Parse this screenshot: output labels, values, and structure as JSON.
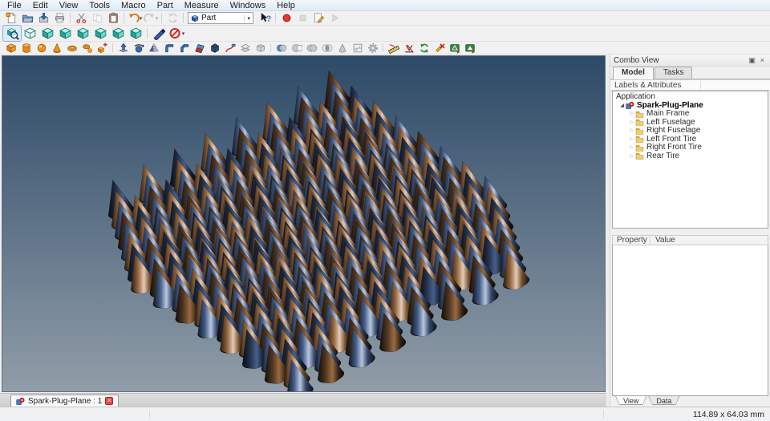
{
  "menubar": {
    "items": [
      "File",
      "Edit",
      "View",
      "Tools",
      "Macro",
      "Part",
      "Measure",
      "Windows",
      "Help"
    ]
  },
  "toolbars": {
    "workbench": {
      "value": "Part"
    },
    "row1_left": [
      {
        "name": "file",
        "items": [
          {
            "id": "new",
            "label": "New"
          },
          {
            "id": "open",
            "label": "Open"
          },
          {
            "id": "save",
            "label": "Save"
          },
          {
            "id": "print",
            "label": "Print"
          }
        ]
      },
      {
        "name": "edit",
        "items": [
          {
            "id": "cut",
            "label": "Cut"
          },
          {
            "id": "copy",
            "label": "Copy",
            "disabled": true
          },
          {
            "id": "paste",
            "label": "Paste"
          }
        ]
      },
      {
        "name": "undo-redo",
        "items": [
          {
            "id": "undo",
            "label": "Undo",
            "dropdown": true
          },
          {
            "id": "redo",
            "label": "Redo",
            "disabled": true,
            "dropdown": true
          }
        ]
      },
      {
        "name": "refresh",
        "items": [
          {
            "id": "refresh",
            "label": "Refresh",
            "disabled": true
          }
        ]
      }
    ],
    "row1_right": [
      {
        "name": "help",
        "items": [
          {
            "id": "whatsthis",
            "label": "What's This?"
          }
        ]
      },
      {
        "name": "macro",
        "items": [
          {
            "id": "record",
            "label": "Macro recording"
          },
          {
            "id": "stop",
            "label": "Stop macro recording",
            "disabled": true
          },
          {
            "id": "macro-edit",
            "label": "Macros..."
          },
          {
            "id": "play",
            "label": "Execute macro",
            "disabled": true
          }
        ]
      }
    ],
    "view_row": [
      {
        "name": "navigation",
        "items": [
          {
            "id": "fit-all",
            "label": "Fit all",
            "active": true
          },
          {
            "id": "axonometric",
            "label": "Axonometric"
          },
          {
            "id": "view-front",
            "label": "Front"
          },
          {
            "id": "view-top",
            "label": "Top"
          },
          {
            "id": "view-right",
            "label": "Right"
          },
          {
            "id": "view-rear",
            "label": "Rear"
          },
          {
            "id": "view-bottom",
            "label": "Bottom"
          },
          {
            "id": "view-left",
            "label": "Left"
          }
        ]
      },
      {
        "name": "view-tools",
        "items": [
          {
            "id": "measure-distance",
            "label": "Measure distance"
          },
          {
            "id": "clipping-plane",
            "label": "Clipping plane",
            "dropdown": true
          }
        ]
      }
    ],
    "part_row": [
      {
        "name": "primitives",
        "items": [
          {
            "id": "box",
            "label": "Box"
          },
          {
            "id": "cylinder",
            "label": "Cylinder"
          },
          {
            "id": "sphere",
            "label": "Sphere"
          },
          {
            "id": "cone",
            "label": "Cone"
          },
          {
            "id": "torus",
            "label": "Torus"
          },
          {
            "id": "create-primitives",
            "label": "Create primitives..."
          },
          {
            "id": "shape-builder",
            "label": "Shape builder..."
          }
        ]
      },
      {
        "name": "modify",
        "items": [
          {
            "id": "extrude",
            "label": "Extrude"
          },
          {
            "id": "revolve",
            "label": "Revolve"
          },
          {
            "id": "mirror",
            "label": "Mirroring"
          },
          {
            "id": "fillet",
            "label": "Fillet"
          },
          {
            "id": "chamfer",
            "label": "Chamfer"
          },
          {
            "id": "ruled-surface",
            "label": "Ruled surface"
          },
          {
            "id": "loft",
            "label": "Loft"
          },
          {
            "id": "sweep",
            "label": "Sweep"
          },
          {
            "id": "offset",
            "label": "Offset"
          },
          {
            "id": "thickness",
            "label": "Thickness"
          }
        ]
      },
      {
        "name": "boolean",
        "items": [
          {
            "id": "boolean",
            "label": "Boolean"
          },
          {
            "id": "cut-bool",
            "label": "Cut"
          },
          {
            "id": "union",
            "label": "Union"
          },
          {
            "id": "intersection",
            "label": "Intersection"
          },
          {
            "id": "connect",
            "label": "Connect"
          },
          {
            "id": "compound",
            "label": "Compound"
          },
          {
            "id": "compound-tools",
            "label": "Compound tools"
          }
        ]
      },
      {
        "name": "measure",
        "items": [
          {
            "id": "measure-linear",
            "label": "Measure Linear"
          },
          {
            "id": "measure-angular",
            "label": "Measure Angular"
          },
          {
            "id": "refresh-measurement",
            "label": "Refresh measurement"
          },
          {
            "id": "clear-measurement",
            "label": "Clear measurement"
          },
          {
            "id": "toggle-3d",
            "label": "Toggle measurement 3D"
          },
          {
            "id": "toggle-delta",
            "label": "Toggle measurement delta"
          }
        ]
      }
    ]
  },
  "combo_view": {
    "title": "Combo View",
    "tabs": [
      "Model",
      "Tasks"
    ],
    "active_tab": "Model",
    "tree_header": "Labels & Attributes",
    "tree": {
      "root": "Application",
      "document": {
        "label": "Spark-Plug-Plane",
        "expanded": true
      },
      "children": [
        "Main Frame",
        "Left Fuselage",
        "Right Fuselage",
        "Left Front Tire",
        "Right Front Tire",
        "Rear Tire"
      ]
    },
    "property_panel": {
      "columns": [
        "Property",
        "Value"
      ],
      "rows": []
    },
    "bottom_tabs": [
      "View",
      "Data"
    ],
    "active_bottom_tab": "View"
  },
  "document_tabs": [
    {
      "label": "Spark-Plug-Plane : 1",
      "active": true,
      "closable": true
    }
  ],
  "statusbar": {
    "dimensions": "114.89 x 64.03 mm"
  },
  "viewport": {
    "background_top": "#2d4a67",
    "background_bottom": "#919da8",
    "model": {
      "name": "Spark-Plug-Plane",
      "type": "cone-lattice",
      "grid": [
        8,
        8,
        8
      ],
      "colors": {
        "copper": "#c08452",
        "steel_blue": "#5878b0"
      }
    }
  }
}
